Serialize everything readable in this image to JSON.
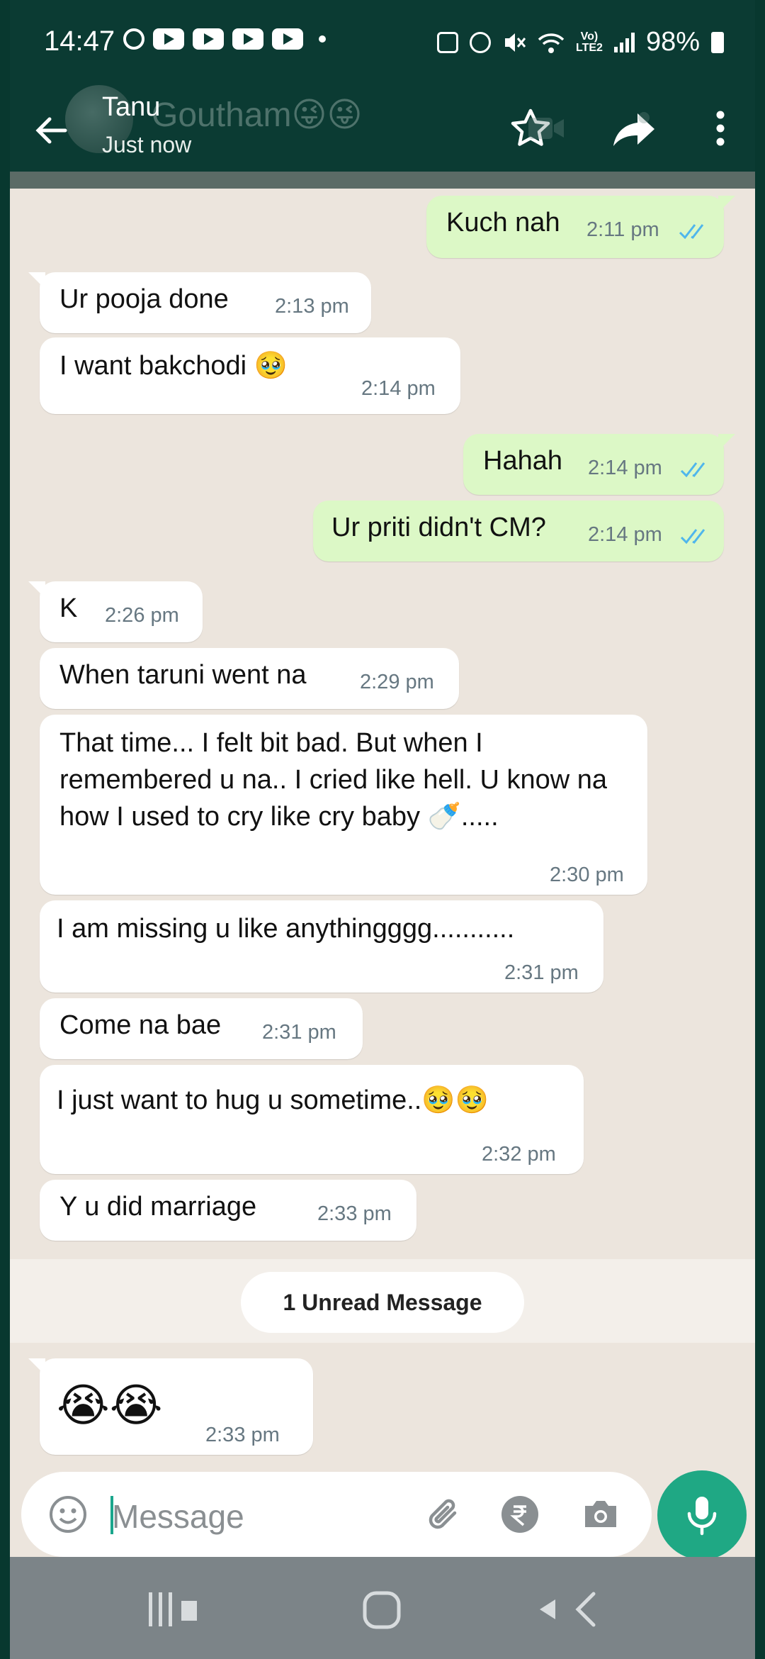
{
  "status_bar": {
    "time": "14:47",
    "volte_top": "Vo)",
    "volte_bottom": "LTE2",
    "battery": "98%"
  },
  "header": {
    "contact_name": "Tanu",
    "ghost_name": "Goutham",
    "ghost_emojis": "😜😜",
    "last_seen": "Just now"
  },
  "messages": [
    {
      "dir": "out",
      "text": "Kuch nah",
      "time": "2:11 pm"
    },
    {
      "dir": "in",
      "text": "Ur pooja done",
      "time": "2:13 pm"
    },
    {
      "dir": "in",
      "text": "I want bakchodi 🥹",
      "time": "2:14 pm"
    },
    {
      "dir": "out",
      "text": "Hahah",
      "time": "2:14 pm"
    },
    {
      "dir": "out",
      "text": "Ur priti didn't CM?",
      "time": "2:14 pm"
    },
    {
      "dir": "in",
      "text": "K",
      "time": "2:26 pm"
    },
    {
      "dir": "in",
      "text": "When taruni went na",
      "time": "2:29 pm"
    },
    {
      "dir": "in",
      "text": "That time... I felt bit bad. But when I remembered u na.. I cried like hell. U know na how I used to cry like cry baby 🍼.....",
      "time": "2:30 pm"
    },
    {
      "dir": "in",
      "text": "I am missing u like  anythingggg...........",
      "time": "2:31 pm"
    },
    {
      "dir": "in",
      "text": "Come na bae",
      "time": "2:31 pm"
    },
    {
      "dir": "in",
      "text": "I just want to hug u sometime..🥹🥹",
      "time": "2:32 pm"
    },
    {
      "dir": "in",
      "text": "Y u did marriage",
      "time": "2:33 pm"
    },
    {
      "dir": "in",
      "text": "😭😭",
      "time": "2:33 pm"
    }
  ],
  "unread_label": "1 Unread Message",
  "input": {
    "placeholder": "Message"
  }
}
